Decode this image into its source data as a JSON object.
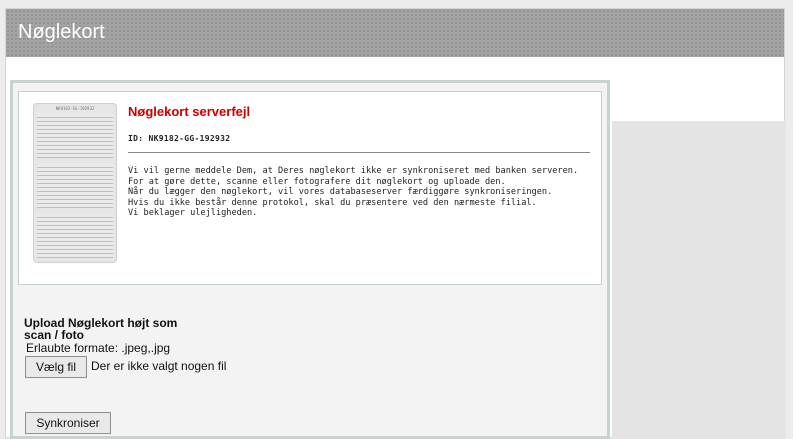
{
  "header": {
    "title": "Nøglekort"
  },
  "card": {
    "image_id": "NK9182-GG-192932",
    "error_title": "Nøglekort serverfejl",
    "id_line": "ID: NK9182-GG-192932",
    "message_lines": [
      "Vi vil gerne meddele Dem, at Deres nøglekort ikke er synkroniseret med banken serveren.",
      "For at gøre dette, scanne eller fotografere dit nøglekort og uploade den.",
      "Når du lægger den nøglekort, vil vores databaseserver færdiggøre synkroniseringen.",
      "Hvis du ikke består denne protokol, skal du præsentere ved den nærmeste filial.",
      "Vi beklager ulejligheden."
    ]
  },
  "upload": {
    "label": "Upload Nøglekort højt som scan / foto",
    "formats": "Erlaubte formate: .jpeg,.jpg",
    "file_button": "Vælg fil",
    "file_status": "Der er ikke valgt nogen fil"
  },
  "actions": {
    "sync_button": "Synkroniser"
  },
  "colors": {
    "error_title": "#cc0000",
    "header_bg": "#a3a3a3",
    "panel_border": "#c7d3d0"
  }
}
